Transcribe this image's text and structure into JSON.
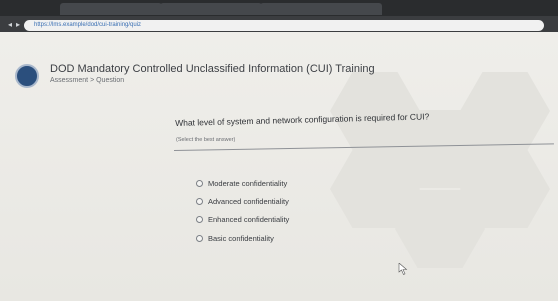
{
  "browser": {
    "tabs": [
      "",
      "",
      ""
    ],
    "address": "https://lms.example/dod/cui-training/quiz"
  },
  "header": {
    "logo_text": "",
    "title": "DOD Mandatory Controlled Unclassified Information (CUI) Training",
    "breadcrumb": "Assessment > Question"
  },
  "question": {
    "text": "What level of system and network configuration is required for CUI?",
    "hint": "(Select the best answer)",
    "options": [
      "Moderate confidentiality",
      "Advanced confidentiality",
      "Enhanced confidentiality",
      "Basic confidentiality"
    ]
  }
}
